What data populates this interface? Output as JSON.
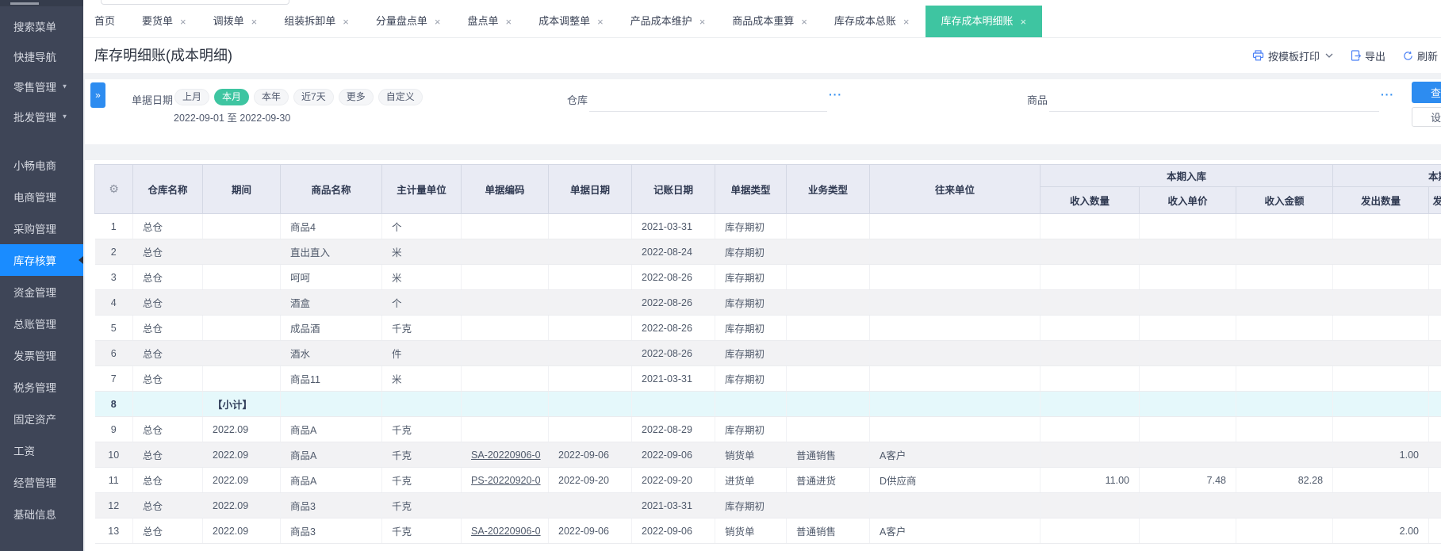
{
  "colors": {
    "accent_blue": "#2d8cf0",
    "sidebar_active_blue": "#1a8cff",
    "active_green": "#3ec5a1",
    "subtotal_row_bg": "#e5f8fb"
  },
  "sidebar": {
    "items": [
      {
        "label": "搜索菜单"
      },
      {
        "label": "快捷导航"
      },
      {
        "label": "零售管理",
        "arrow": "▼"
      },
      {
        "label": "批发管理",
        "arrow": "▼"
      },
      {
        "label": "小畅电商"
      },
      {
        "label": "电商管理"
      },
      {
        "label": "采购管理"
      },
      {
        "label": "库存核算",
        "active": true
      },
      {
        "label": "资金管理"
      },
      {
        "label": "总账管理"
      },
      {
        "label": "发票管理"
      },
      {
        "label": "税务管理"
      },
      {
        "label": "固定资产"
      },
      {
        "label": "工资"
      },
      {
        "label": "经营管理"
      },
      {
        "label": "基础信息"
      }
    ]
  },
  "tabs": [
    {
      "label": "首页",
      "closable": false
    },
    {
      "label": "要货单",
      "closable": true
    },
    {
      "label": "调拨单",
      "closable": true
    },
    {
      "label": "组装拆卸单",
      "closable": true
    },
    {
      "label": "分量盘点单",
      "closable": true
    },
    {
      "label": "盘点单",
      "closable": true
    },
    {
      "label": "成本调整单",
      "closable": true
    },
    {
      "label": "产品成本维护",
      "closable": true
    },
    {
      "label": "商品成本重算",
      "closable": true
    },
    {
      "label": "库存成本总账",
      "closable": true
    },
    {
      "label": "库存成本明细账",
      "closable": true,
      "active": true
    }
  ],
  "page": {
    "title": "库存明细账(成本明细)"
  },
  "toolbar": {
    "print_label": "按模板打印",
    "export_label": "导出",
    "refresh_label": "刷新"
  },
  "filters": {
    "date_label": "单据日期",
    "date_options": [
      "上月",
      "本月",
      "本年",
      "近7天",
      "更多",
      "自定义"
    ],
    "date_active": "本月",
    "date_range": "2022-09-01 至 2022-09-30",
    "warehouse_label": "仓库",
    "product_label": "商品",
    "more_icon": "···",
    "query_button": "查询",
    "settings_button": "设置"
  },
  "table": {
    "group_headers": [
      {
        "label": "本期入库"
      },
      {
        "label": "本期出库"
      }
    ],
    "main_columns": [
      "仓库名称",
      "期间",
      "商品名称",
      "主计量单位",
      "单据编码",
      "单据日期",
      "记账日期",
      "单据类型",
      "业务类型",
      "往来单位"
    ],
    "sub_columns": [
      "收入数量",
      "收入单价",
      "收入金额",
      "发出数量",
      "发出单价"
    ],
    "rows": [
      {
        "num": "1",
        "warehouse": "总仓",
        "period": "",
        "product": "商品4",
        "unit": "个",
        "code": "",
        "doc_date": "",
        "book_date": "2021-03-31",
        "doc_type": "库存期初",
        "biz_type": "",
        "partner": "",
        "in_qty": "",
        "in_price": "",
        "in_amount": "",
        "out_qty": ""
      },
      {
        "num": "2",
        "warehouse": "总仓",
        "period": "",
        "product": "直出直入",
        "unit": "米",
        "code": "",
        "doc_date": "",
        "book_date": "2022-08-24",
        "doc_type": "库存期初",
        "biz_type": "",
        "partner": "",
        "in_qty": "",
        "in_price": "",
        "in_amount": "",
        "out_qty": ""
      },
      {
        "num": "3",
        "warehouse": "总仓",
        "period": "",
        "product": "呵呵",
        "unit": "米",
        "code": "",
        "doc_date": "",
        "book_date": "2022-08-26",
        "doc_type": "库存期初",
        "biz_type": "",
        "partner": "",
        "in_qty": "",
        "in_price": "",
        "in_amount": "",
        "out_qty": ""
      },
      {
        "num": "4",
        "warehouse": "总仓",
        "period": "",
        "product": "酒盒",
        "unit": "个",
        "code": "",
        "doc_date": "",
        "book_date": "2022-08-26",
        "doc_type": "库存期初",
        "biz_type": "",
        "partner": "",
        "in_qty": "",
        "in_price": "",
        "in_amount": "",
        "out_qty": ""
      },
      {
        "num": "5",
        "warehouse": "总仓",
        "period": "",
        "product": "成品酒",
        "unit": "千克",
        "code": "",
        "doc_date": "",
        "book_date": "2022-08-26",
        "doc_type": "库存期初",
        "biz_type": "",
        "partner": "",
        "in_qty": "",
        "in_price": "",
        "in_amount": "",
        "out_qty": ""
      },
      {
        "num": "6",
        "warehouse": "总仓",
        "period": "",
        "product": "酒水",
        "unit": "件",
        "code": "",
        "doc_date": "",
        "book_date": "2022-08-26",
        "doc_type": "库存期初",
        "biz_type": "",
        "partner": "",
        "in_qty": "",
        "in_price": "",
        "in_amount": "",
        "out_qty": ""
      },
      {
        "num": "7",
        "warehouse": "总仓",
        "period": "",
        "product": "商品11",
        "unit": "米",
        "code": "",
        "doc_date": "",
        "book_date": "2021-03-31",
        "doc_type": "库存期初",
        "biz_type": "",
        "partner": "",
        "in_qty": "",
        "in_price": "",
        "in_amount": "",
        "out_qty": ""
      },
      {
        "num": "8",
        "subtotal": true,
        "warehouse": "",
        "period": "【小计】",
        "product": "",
        "unit": "",
        "code": "",
        "doc_date": "",
        "book_date": "",
        "doc_type": "",
        "biz_type": "",
        "partner": "",
        "in_qty": "",
        "in_price": "",
        "in_amount": "",
        "out_qty": ""
      },
      {
        "num": "9",
        "warehouse": "总仓",
        "period": "2022.09",
        "product": "商品A",
        "unit": "千克",
        "code": "",
        "doc_date": "",
        "book_date": "2022-08-29",
        "doc_type": "库存期初",
        "biz_type": "",
        "partner": "",
        "in_qty": "",
        "in_price": "",
        "in_amount": "",
        "out_qty": ""
      },
      {
        "num": "10",
        "warehouse": "总仓",
        "period": "2022.09",
        "product": "商品A",
        "unit": "千克",
        "code": "SA-20220906-0",
        "doc_date": "2022-09-06",
        "book_date": "2022-09-06",
        "doc_type": "销货单",
        "biz_type": "普通销售",
        "partner": "A客户",
        "in_qty": "",
        "in_price": "",
        "in_amount": "",
        "out_qty": "1.00"
      },
      {
        "num": "11",
        "warehouse": "总仓",
        "period": "2022.09",
        "product": "商品A",
        "unit": "千克",
        "code": "PS-20220920-0",
        "doc_date": "2022-09-20",
        "book_date": "2022-09-20",
        "doc_type": "进货单",
        "biz_type": "普通进货",
        "partner": "D供应商",
        "in_qty": "11.00",
        "in_price": "7.48",
        "in_amount": "82.28",
        "out_qty": ""
      },
      {
        "num": "12",
        "warehouse": "总仓",
        "period": "2022.09",
        "product": "商品3",
        "unit": "千克",
        "code": "",
        "doc_date": "",
        "book_date": "2021-03-31",
        "doc_type": "库存期初",
        "biz_type": "",
        "partner": "",
        "in_qty": "",
        "in_price": "",
        "in_amount": "",
        "out_qty": ""
      },
      {
        "num": "13",
        "warehouse": "总仓",
        "period": "2022.09",
        "product": "商品3",
        "unit": "千克",
        "code": "SA-20220906-0",
        "doc_date": "2022-09-06",
        "book_date": "2022-09-06",
        "doc_type": "销货单",
        "biz_type": "普通销售",
        "partner": "A客户",
        "in_qty": "",
        "in_price": "",
        "in_amount": "",
        "out_qty": "2.00"
      }
    ]
  }
}
